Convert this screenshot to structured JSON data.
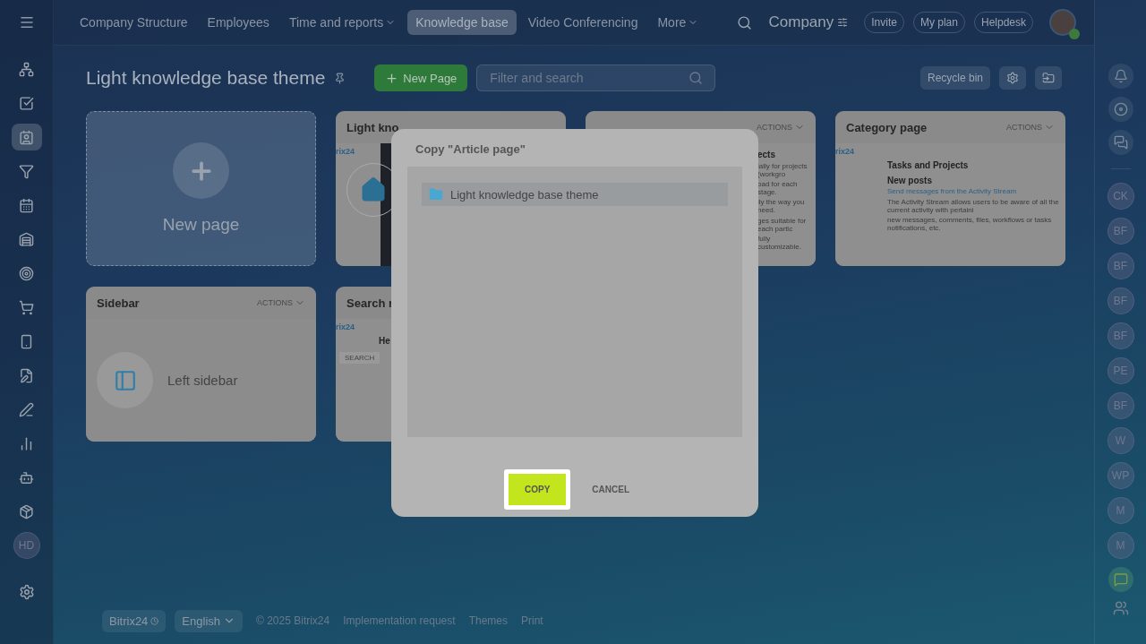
{
  "topbar": {
    "nav": [
      {
        "label": "Company Structure",
        "dropdown": false,
        "selected": false
      },
      {
        "label": "Employees",
        "dropdown": false,
        "selected": false
      },
      {
        "label": "Time and reports",
        "dropdown": true,
        "selected": false
      },
      {
        "label": "Knowledge base",
        "dropdown": false,
        "selected": true
      },
      {
        "label": "Video Conferencing",
        "dropdown": false,
        "selected": false
      },
      {
        "label": "More",
        "dropdown": true,
        "selected": false
      }
    ],
    "company": "Company",
    "buttons": [
      "Invite",
      "My plan",
      "Helpdesk"
    ]
  },
  "left_sidebar": {
    "items": [
      {
        "selected": false
      },
      {
        "selected": false
      },
      {
        "selected": true
      },
      {
        "selected": false
      },
      {
        "selected": false
      },
      {
        "selected": false
      },
      {
        "selected": false
      },
      {
        "selected": false
      },
      {
        "selected": false
      },
      {
        "selected": false
      },
      {
        "selected": false
      },
      {
        "selected": false
      },
      {
        "selected": false
      },
      {
        "selected": false
      }
    ],
    "avatar": "HD"
  },
  "header": {
    "title": "Light knowledge base theme",
    "new_button": "New Page",
    "search": {
      "placeholder": "Filter and search"
    },
    "recycle_bin": "Recycle bin"
  },
  "cards": [
    {
      "kind": "new",
      "title": "New page"
    },
    {
      "kind": "page",
      "title": "Light kno",
      "preview": {
        "kind": "home",
        "items": [
          {
            "kind": "logo",
            "text": "rix24"
          }
        ]
      }
    },
    {
      "kind": "page",
      "actions": "ACTIONS",
      "preview": {
        "kind": "article",
        "items": [
          {
            "kind": "heading",
            "text": "ects"
          },
          {
            "kind": "text",
            "text": "ially for projects (workgro"
          },
          {
            "kind": "text",
            "text": "oad for each stage."
          },
          {
            "kind": "text",
            "text": "lly the way you need."
          },
          {
            "kind": "text",
            "text": "ges suitable for each partic"
          },
          {
            "kind": "text",
            "text": "fully customizable."
          }
        ]
      }
    },
    {
      "kind": "page",
      "title": "Category page",
      "actions": "ACTIONS",
      "preview": {
        "kind": "page",
        "items": [
          {
            "kind": "logo",
            "text": "rix24"
          },
          {
            "kind": "heading",
            "text": "Tasks and Projects"
          },
          {
            "kind": "heading",
            "text": "New posts"
          },
          {
            "kind": "link",
            "text": "Send messages from the Activity Stream"
          },
          {
            "kind": "text",
            "text": "The Activity Stream allows users to be aware of all the current activity with pertaini"
          },
          {
            "kind": "text",
            "text": "new messages, comments, files, workflows or tasks notifications, etc."
          }
        ]
      }
    },
    {
      "kind": "sidebar",
      "title": "Sidebar",
      "actions": "ACTIONS",
      "label": "Left sidebar"
    },
    {
      "kind": "page",
      "title": "Search r",
      "preview": {
        "kind": "search",
        "items": [
          {
            "kind": "logo",
            "text": "rix24"
          },
          {
            "kind": "heading",
            "text": "He"
          },
          {
            "kind": "button",
            "text": "SEARCH"
          }
        ]
      }
    }
  ],
  "dialog": {
    "title": "Copy \"Article page\"",
    "items": [
      {
        "label": "Light knowledge base theme",
        "selected": true
      }
    ],
    "buttons": [
      {
        "label": "COPY",
        "kind": "primary"
      },
      {
        "label": "CANCEL",
        "kind": "link"
      }
    ]
  },
  "right_sidebar": {
    "avatars": [
      "CK",
      "BF",
      "BF",
      "BF",
      "BF",
      "PE",
      "BF",
      "W",
      "WP",
      "M",
      "M"
    ]
  },
  "footer": {
    "brand": "Bitrix24",
    "language": "English",
    "links": [
      "© 2025 Bitrix24",
      "Implementation request",
      "Themes",
      "Print"
    ]
  }
}
